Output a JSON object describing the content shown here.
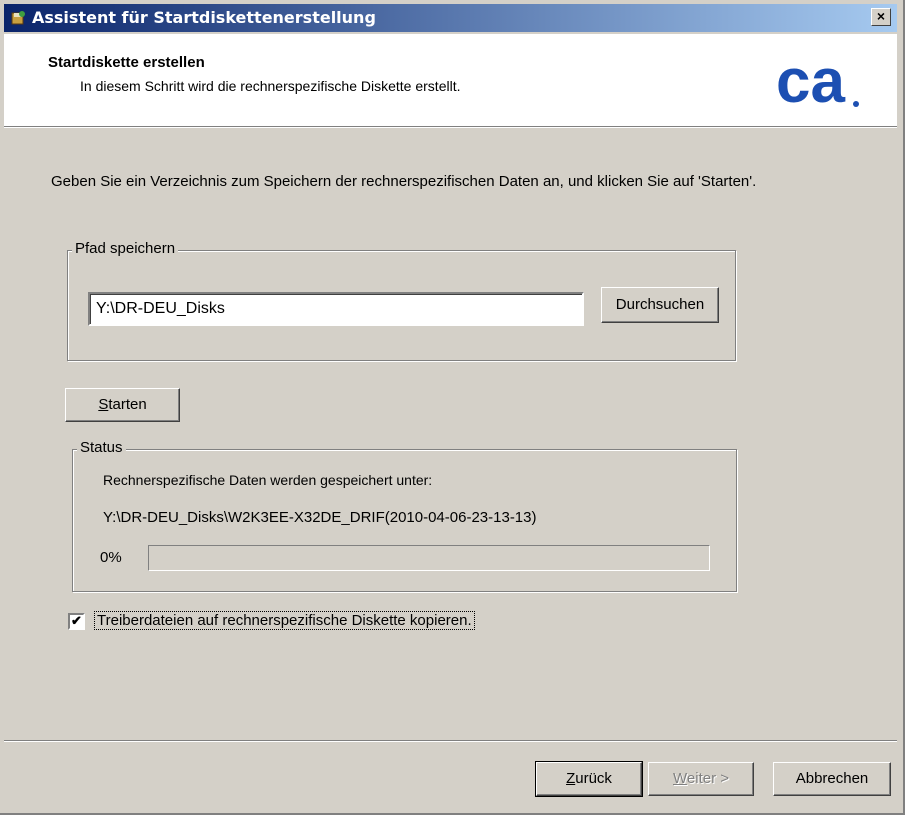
{
  "window": {
    "title": "Assistent für Startdiskettenerstellung",
    "close_label": "×"
  },
  "header": {
    "title": "Startdiskette erstellen",
    "subtitle": "In diesem Schritt wird die rechnerspezifische Diskette erstellt.",
    "logo_text": "ca",
    "logo_color": "#1c4fb2"
  },
  "instruction": "Geben Sie ein Verzeichnis zum Speichern der rechnerspezifischen Daten an, und klicken Sie auf 'Starten'.",
  "save_path": {
    "group_label": "Pfad speichern",
    "value": "Y:\\DR-DEU_Disks",
    "browse_label": "Durchsuchen"
  },
  "start_button": {
    "label_underlined": "S",
    "label_rest": "tarten"
  },
  "status": {
    "group_label": "Status",
    "message": "Rechnerspezifische Daten werden gespeichert unter:",
    "path": "Y:\\DR-DEU_Disks\\W2K3EE-X32DE_DRIF(2010-04-06-23-13-13)",
    "percent_text": "0%",
    "progress": 0
  },
  "driver_option": {
    "checked": true,
    "label": "Treiberdateien auf rechnerspezifische Diskette kopieren."
  },
  "footer": {
    "back": {
      "underlined": "Z",
      "rest": "urück"
    },
    "next": {
      "underlined": "W",
      "rest": "eiter >"
    },
    "cancel": "Abbrechen"
  }
}
